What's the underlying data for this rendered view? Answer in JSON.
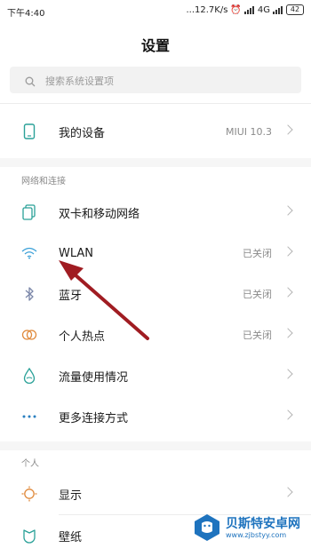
{
  "status_bar": {
    "time": "下午4:40",
    "net_speed": "...12.7K/s",
    "network": "4G",
    "battery": "42"
  },
  "header": {
    "title": "设置"
  },
  "search": {
    "placeholder": "搜索系统设置项"
  },
  "device_row": {
    "label": "我的设备",
    "value": "MIUI 10.3"
  },
  "network_section": {
    "title": "网络和连接",
    "items": [
      {
        "label": "双卡和移动网络",
        "value": "",
        "icon": "sim-card-icon"
      },
      {
        "label": "WLAN",
        "value": "已关闭",
        "icon": "wifi-icon"
      },
      {
        "label": "蓝牙",
        "value": "已关闭",
        "icon": "bluetooth-icon"
      },
      {
        "label": "个人热点",
        "value": "已关闭",
        "icon": "hotspot-icon"
      },
      {
        "label": "流量使用情况",
        "value": "",
        "icon": "data-usage-icon"
      },
      {
        "label": "更多连接方式",
        "value": "",
        "icon": "more-dots-icon"
      }
    ]
  },
  "personal_section": {
    "title": "个人",
    "items": [
      {
        "label": "显示",
        "icon": "display-icon"
      },
      {
        "label": "壁纸",
        "icon": "wallpaper-icon"
      }
    ]
  },
  "watermark": {
    "title": "贝斯特安卓网",
    "url": "www.zjbstyy.com"
  },
  "colors": {
    "accent_teal": "#2aa198",
    "arrow_red": "#a01c22",
    "wifi_blue": "#3aa0d8"
  }
}
